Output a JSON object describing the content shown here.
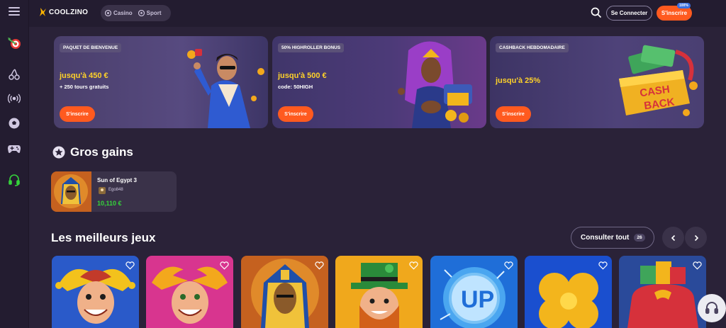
{
  "header": {
    "logo_text": "COOLZINO",
    "toggle": {
      "casino": "Casino",
      "sport": "Sport"
    },
    "login": "Se Connecter",
    "signup": "S'inscrire",
    "signup_badge": "100%"
  },
  "sidebar": {
    "items": [
      "menu-icon",
      "dart-icon",
      "cherries-icon",
      "live-broadcast-icon",
      "soccer-ball-icon",
      "gamepad-icon",
      "headset-icon"
    ]
  },
  "banners": [
    {
      "label": "PAQUET DE BIENVENUE",
      "amount": "jusqu'à 450 €",
      "sub": "+ 250 tours gratuits",
      "cta": "S'inscrire"
    },
    {
      "label": "50% HIGHROLLER BONUS",
      "amount": "jusqu'à 500 €",
      "sub": "code: 50HIGH",
      "cta": "S'inscrire"
    },
    {
      "label": "CASHBACK HEBDOMADAIRE",
      "amount": "jusqu'à 25%",
      "sub": "",
      "cta": "S'inscrire",
      "art_text_1": "CASH",
      "art_text_2": "BACK"
    }
  ],
  "big_wins": {
    "title": "Gros gains",
    "items": [
      {
        "game": "Sun of Egypt 3",
        "user": "Ego848",
        "amount": "10,110 €"
      }
    ]
  },
  "best_games": {
    "title": "Les meilleurs jeux",
    "view_all": "Consulter tout",
    "count": "26",
    "tiles": [
      {
        "icon": "jester-icon"
      },
      {
        "icon": "jester-icon"
      },
      {
        "icon": "pharaoh-icon"
      },
      {
        "icon": "leprechaun-icon"
      },
      {
        "icon": "up-coin-icon",
        "art_text": "UP"
      },
      {
        "icon": "clover-icon"
      },
      {
        "icon": "gift-bag-icon"
      }
    ]
  },
  "colors": {
    "accent": "#ff5a1f",
    "gold": "#ffd229",
    "win_green": "#35d33b",
    "background": "#2a2238",
    "panel": "#231c30"
  }
}
